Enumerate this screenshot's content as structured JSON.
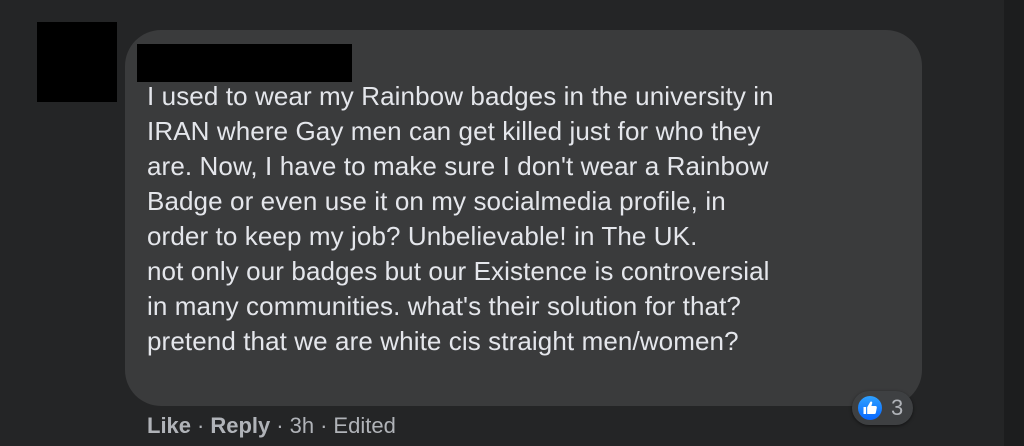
{
  "comment": {
    "avatar_label": "",
    "author_name": "",
    "text_lines": [
      "I used to wear my Rainbow badges in the university in",
      "IRAN where Gay men can get killed just for who they",
      "are. Now, I have to make sure I don't wear a Rainbow",
      "Badge or even use it on my socialmedia profile, in",
      "order to keep my job? Unbelievable! in The UK.",
      "not only our badges but our Existence is controversial",
      "in many communities. what's their solution for that?",
      "pretend that we are white cis straight men/women?"
    ],
    "reactions": {
      "icon": "like-icon",
      "count": "3"
    },
    "actions": {
      "like_label": "Like",
      "separator": "·",
      "reply_label": "Reply",
      "timestamp": "3h",
      "edited_label": "Edited"
    }
  },
  "colors": {
    "background": "#242526",
    "bubble": "#3a3b3c",
    "text": "#e4e6eb",
    "secondary_text": "#b0b3b8",
    "like_blue": "#1877f2"
  }
}
